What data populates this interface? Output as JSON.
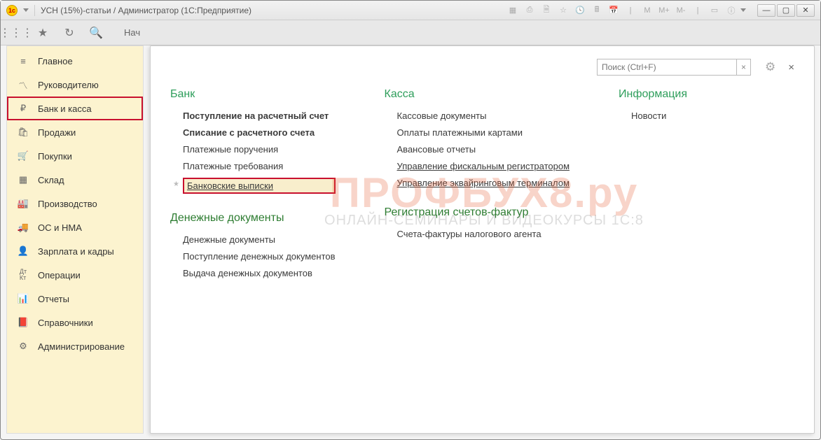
{
  "titlebar": {
    "title": "УСН (15%)-статьи / Администратор  (1С:Предприятие)"
  },
  "toolbar": {
    "tab_label": "Нач"
  },
  "sidebar": {
    "items": [
      {
        "label": "Главное",
        "icon": "menu"
      },
      {
        "label": "Руководителю",
        "icon": "chart"
      },
      {
        "label": "Банк и касса",
        "icon": "ruble",
        "active": true
      },
      {
        "label": "Продажи",
        "icon": "bag"
      },
      {
        "label": "Покупки",
        "icon": "cart"
      },
      {
        "label": "Склад",
        "icon": "boxes"
      },
      {
        "label": "Производство",
        "icon": "factory"
      },
      {
        "label": "ОС и НМА",
        "icon": "truck"
      },
      {
        "label": "Зарплата и кадры",
        "icon": "person"
      },
      {
        "label": "Операции",
        "icon": "dtkt"
      },
      {
        "label": "Отчеты",
        "icon": "bars"
      },
      {
        "label": "Справочники",
        "icon": "book"
      },
      {
        "label": "Администрирование",
        "icon": "gear"
      }
    ]
  },
  "panel": {
    "search_placeholder": "Поиск (Ctrl+F)",
    "sections": {
      "bank": {
        "title": "Банк",
        "items": [
          {
            "label": "Поступление на расчетный счет",
            "bold": true
          },
          {
            "label": "Списание с расчетного счета",
            "bold": true
          },
          {
            "label": "Платежные поручения"
          },
          {
            "label": "Платежные требования"
          },
          {
            "label": "Банковские выписки",
            "highlighted": true,
            "star": true,
            "underline": true
          }
        ]
      },
      "money_docs": {
        "title": "Денежные документы",
        "items": [
          {
            "label": "Денежные документы"
          },
          {
            "label": "Поступление денежных документов"
          },
          {
            "label": "Выдача денежных документов"
          }
        ]
      },
      "kassa": {
        "title": "Касса",
        "items": [
          {
            "label": "Кассовые документы"
          },
          {
            "label": "Оплаты платежными картами"
          },
          {
            "label": "Авансовые отчеты"
          },
          {
            "label": "Управление фискальным регистратором",
            "underline": true
          },
          {
            "label": "Управление эквайринговым терминалом",
            "underline": true
          }
        ]
      },
      "invoices": {
        "title": "Регистрация счетов-фактур",
        "items": [
          {
            "label": "Счета-фактуры налогового агента"
          }
        ]
      },
      "info": {
        "title": "Информация",
        "items": [
          {
            "label": "Новости"
          }
        ]
      }
    }
  },
  "watermark": {
    "big": "ПРОФБУХ8.ру",
    "sub": "ОНЛАЙН-СЕМИНАРЫ И ВИДЕОКУРСЫ 1С:8"
  },
  "top_buttons": [
    "M",
    "M+",
    "M-"
  ]
}
